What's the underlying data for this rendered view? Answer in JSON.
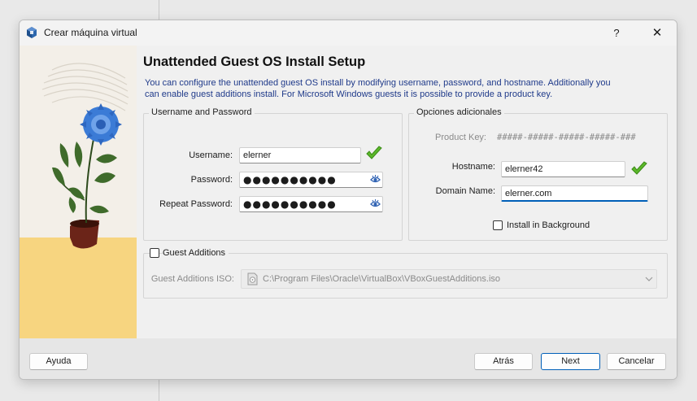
{
  "window": {
    "title": "Crear máquina virtual",
    "help": "?",
    "close": "✕"
  },
  "page": {
    "heading": "Unattended Guest OS Install Setup",
    "description": "You can configure the unattended guest OS install by modifying username, password, and hostname. Additionally you can enable guest additions install. For Microsoft Windows guests it is possible to provide a product key."
  },
  "credentials": {
    "group_title": "Username and Password",
    "username_label": "Username:",
    "username_value": "elerner",
    "password_label": "Password:",
    "password_value": "●●●●●●●●●●",
    "repeat_label": "Repeat Password:",
    "repeat_value": "●●●●●●●●●●"
  },
  "options": {
    "group_title": "Opciones adicionales",
    "product_key_label": "Product Key:",
    "product_key_value": "#####-#####-#####-#####-###",
    "hostname_label": "Hostname:",
    "hostname_value": "elerner42",
    "domain_label": "Domain Name:",
    "domain_value": "elerner.com",
    "install_bg_label": "Install in Background",
    "install_bg_checked": false
  },
  "guest_additions": {
    "checkbox_label": "Guest Additions",
    "checked": false,
    "iso_label": "Guest Additions ISO:",
    "iso_value": "C:\\Program Files\\Oracle\\VirtualBox\\VBoxGuestAdditions.iso"
  },
  "footer": {
    "help": "Ayuda",
    "back": "Atrás",
    "next": "Next",
    "cancel": "Cancelar"
  },
  "colors": {
    "accent": "#005fb8",
    "description_text": "#1f3a8a",
    "valid_check": "#5cb82a"
  },
  "icons": [
    "virtualbox-icon",
    "check-icon",
    "eye-icon",
    "disk-icon",
    "chevron-down-icon"
  ]
}
